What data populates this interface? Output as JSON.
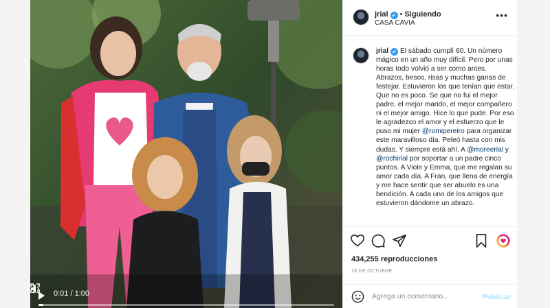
{
  "post": {
    "username": "jrial",
    "verified_mark": "✔",
    "separator": "•",
    "follow_status": "Siguiendo",
    "location": "CASA CAVIA",
    "options_icon": "more-horizontal-icon"
  },
  "caption": {
    "username": "jrial",
    "parts": {
      "p1": "El sábado cumplí 60. Un número mágico en un año muy difícil. Pero por unas horas todo volvió a ser como antes. Abrazos, besos, risas y muchas ganas de festejar. Estuvieron los que tenían que estar. Que no es poco. Se que no fui el mejor padre, el mejor marido, el mejor compañero ni el mejor amigo. Hice lo que pude. Por eso le agradezco el amor y el esfuerzo que le puso mi mujer ",
      "m1": "@romipereiro",
      "p2": " para organizar este maravilloso día. Peleó hasta con mis dudas. Y siempre está ahí. A ",
      "m2": "@moreerial",
      "p3": " y ",
      "m3": "@rochirial",
      "p4": " por soportar a un padre cinco puntos. A Viole y Emma, que me regalan su amor cada día. A Fran, que llena de energía y me hace sentir que ser abuelo es una bendición. A cada uno de los amigos que estuvieron dándome un abrazo."
    }
  },
  "video": {
    "time": "0:01 / 1:00",
    "progress": 0.017,
    "play_icon": "play-icon",
    "volume_icon": "volume-icon",
    "fullscreen_icon": "fullscreen-icon",
    "more_icon": "more-vertical-icon",
    "heart_symbol": "♥"
  },
  "stats": {
    "views": "434,255 reproducciones",
    "date": "18 DE OCTUBRE"
  },
  "comment_box": {
    "placeholder": "Agrega un comentario...",
    "publish_label": "Publicar"
  },
  "colors": {
    "link": "#00376b",
    "verified": "#3897f0",
    "publish_disabled": "#b2dffc"
  }
}
